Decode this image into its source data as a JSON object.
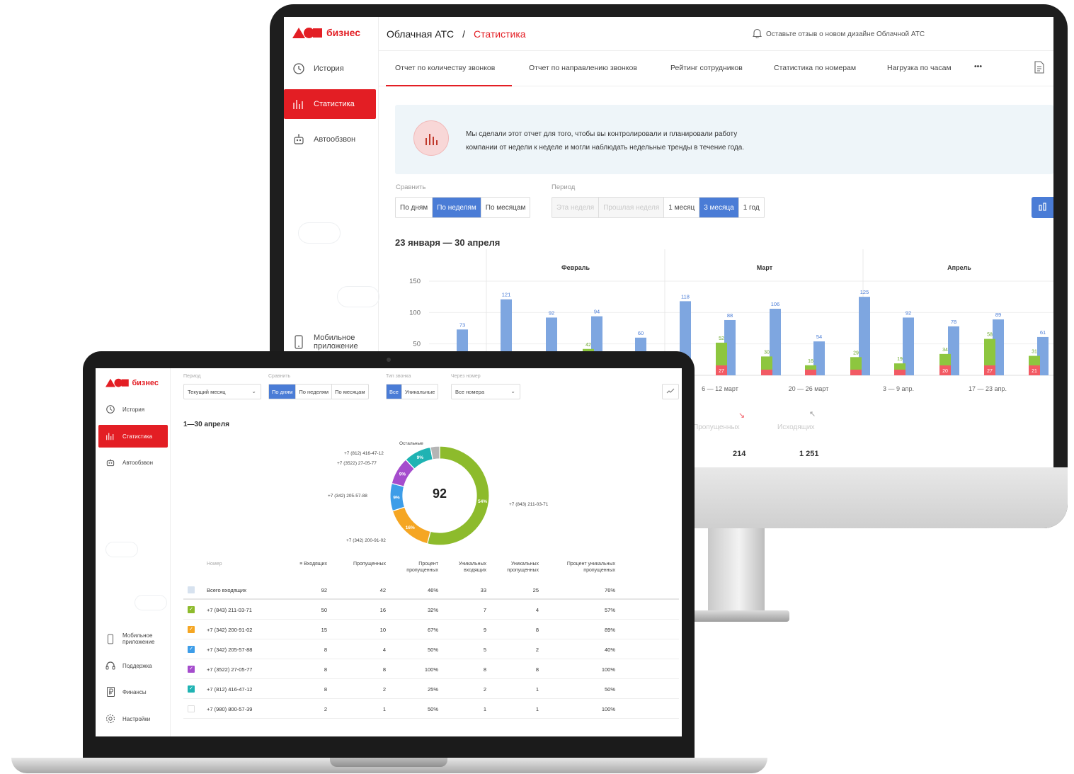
{
  "brand": {
    "name": "бизнес",
    "color": "#e31e24"
  },
  "monitor": {
    "sidebar": [
      {
        "label": "История",
        "icon": "clock-icon"
      },
      {
        "label": "Статистика",
        "icon": "bar-chart-icon",
        "active": true
      },
      {
        "label": "Автообзвон",
        "icon": "robot-icon"
      },
      {
        "label": "Мобильное приложение",
        "icon": "phone-icon"
      }
    ],
    "breadcrumb": {
      "root": "Облачная АТС",
      "sep": "/",
      "current": "Статистика"
    },
    "feedback": "Оставьте отзыв о новом дизайне Облачной АТС",
    "tabs": [
      "Отчет по количеству звонков",
      "Отчет по направлению звонков",
      "Рейтинг сотрудников",
      "Статистика по номерам",
      "Нагрузка по часам",
      "•••"
    ],
    "info_line1": "Мы сделали этот отчет для того, чтобы вы контролировали и планировали работу",
    "info_line2": "компании от недели к неделе и могли наблюдать недельные тренды в течение года.",
    "compare_label": "Сравнить",
    "compare_options": [
      "По дням",
      "По неделям",
      "По месяцам"
    ],
    "compare_selected": 1,
    "period_label": "Период",
    "period_options": [
      "Эта неделя",
      "Прошлая неделя",
      "1 месяц",
      "3 месяца",
      "1 год"
    ],
    "period_selected": 3,
    "range_title": "23 января — 30 апреля",
    "totals": {
      "missed_label": "Пропущенных",
      "missed_value": "214",
      "outgoing_label": "Исходящих",
      "outgoing_value": "1 251"
    }
  },
  "chart_data": [
    {
      "type": "bar",
      "title": "23 января — 30 апреля",
      "month_labels": [
        "Февраль",
        "Март",
        "Апрель"
      ],
      "x_tick_labels": [
        "6 — 12 март",
        "20 — 26 март",
        "3 — 9 апр.",
        "17 — 23 апр."
      ],
      "ylim": [
        0,
        150
      ],
      "y_ticks": [
        150,
        100,
        50
      ],
      "grid": true,
      "series": [
        {
          "name": "Входящих",
          "color": "#7ea6e0",
          "values": [
            73,
            121,
            92,
            94,
            60,
            118,
            88,
            106,
            54,
            125,
            92,
            78,
            89,
            61
          ]
        },
        {
          "name": "Пропущенных",
          "color": "#8dc63f",
          "values": [
            null,
            null,
            null,
            42,
            null,
            null,
            52,
            30,
            16,
            29,
            19,
            34,
            58,
            31
          ]
        },
        {
          "name": "Пропущенных",
          "color": "#f25a64",
          "values": [
            null,
            null,
            null,
            null,
            null,
            null,
            27,
            null,
            null,
            null,
            null,
            20,
            27,
            21
          ]
        }
      ],
      "category_visible": [
        true,
        true,
        true,
        true,
        true,
        true,
        true,
        true,
        true,
        true,
        true,
        true,
        true,
        true
      ]
    },
    {
      "type": "pie",
      "center_value": "92",
      "slices": [
        {
          "label": "+7 (843) 211-03-71",
          "percent": 54,
          "value_label": "54%",
          "color": "#8dbb2c"
        },
        {
          "label": "+7 (342) 200-91-02",
          "percent": 16,
          "value_label": "16%",
          "color": "#f5a623"
        },
        {
          "label": "+7 (342) 205-57-88",
          "percent": 9,
          "value_label": "9%",
          "color": "#3d9de8"
        },
        {
          "label": "+7 (3522) 27-05-77",
          "percent": 9,
          "value_label": "9%",
          "color": "#a54ccd"
        },
        {
          "label": "+7 (812) 416-47-12",
          "percent": 9,
          "value_label": "9%",
          "color": "#1fb3b3"
        },
        {
          "label": "Остальные",
          "percent": 3,
          "value_label": "",
          "color": "#b5b5b5"
        }
      ]
    }
  ],
  "laptop": {
    "sidebar": [
      {
        "label": "История",
        "icon": "clock-icon"
      },
      {
        "label": "Статистика",
        "icon": "bar-chart-icon",
        "active": true
      },
      {
        "label": "Автообзвон",
        "icon": "robot-icon"
      },
      {
        "label": "Мобильное приложение",
        "icon": "phone-icon"
      },
      {
        "label": "Поддержка",
        "icon": "headset-icon"
      },
      {
        "label": "Финансы",
        "icon": "ruble-icon"
      },
      {
        "label": "Настройки",
        "icon": "gear-icon"
      }
    ],
    "filters": {
      "period_label": "Период",
      "period_value": "Текущий месяц",
      "compare_label": "Сравнить",
      "compare_options": [
        "По дням",
        "По неделям",
        "По месяцам"
      ],
      "compare_selected": 0,
      "call_type_label": "Тип звонка",
      "call_type_options": [
        "Все",
        "Уникальные"
      ],
      "call_type_selected": 0,
      "via_number_label": "Через номер",
      "via_number_value": "Все номера"
    },
    "range_title": "1—30 апреля",
    "table": {
      "headers": [
        "Номер",
        "Входящих",
        "Пропущенных",
        "Процент пропущенных",
        "Уникальных входящих",
        "Уникальных пропущенных",
        "Процент уникальных пропущенных"
      ],
      "rows": [
        {
          "number": "Всего входящих",
          "incoming": "92",
          "missed": "42",
          "pct": "46%",
          "uniq_in": "33",
          "uniq_missed": "25",
          "uniq_pct": "76%",
          "color": "#d7e2ef",
          "checked": false
        },
        {
          "number": "+7 (843) 211-03-71",
          "incoming": "50",
          "missed": "16",
          "pct": "32%",
          "uniq_in": "7",
          "uniq_missed": "4",
          "uniq_pct": "57%",
          "color": "#8dbb2c",
          "checked": true
        },
        {
          "number": "+7 (342) 200-91-02",
          "incoming": "15",
          "missed": "10",
          "pct": "67%",
          "uniq_in": "9",
          "uniq_missed": "8",
          "uniq_pct": "89%",
          "color": "#f5a623",
          "checked": true
        },
        {
          "number": "+7 (342) 205-57-88",
          "incoming": "8",
          "missed": "4",
          "pct": "50%",
          "uniq_in": "5",
          "uniq_missed": "2",
          "uniq_pct": "40%",
          "color": "#3d9de8",
          "checked": true
        },
        {
          "number": "+7 (3522) 27-05-77",
          "incoming": "8",
          "missed": "8",
          "pct": "100%",
          "uniq_in": "8",
          "uniq_missed": "8",
          "uniq_pct": "100%",
          "color": "#a54ccd",
          "checked": true
        },
        {
          "number": "+7 (812) 416-47-12",
          "incoming": "8",
          "missed": "2",
          "pct": "25%",
          "uniq_in": "2",
          "uniq_missed": "1",
          "uniq_pct": "50%",
          "color": "#1fb3b3",
          "checked": true
        },
        {
          "number": "+7 (980) 800-57-39",
          "incoming": "2",
          "missed": "1",
          "pct": "50%",
          "uniq_in": "1",
          "uniq_missed": "1",
          "uniq_pct": "100%",
          "color": "#ffffff",
          "checked": false
        }
      ]
    }
  }
}
